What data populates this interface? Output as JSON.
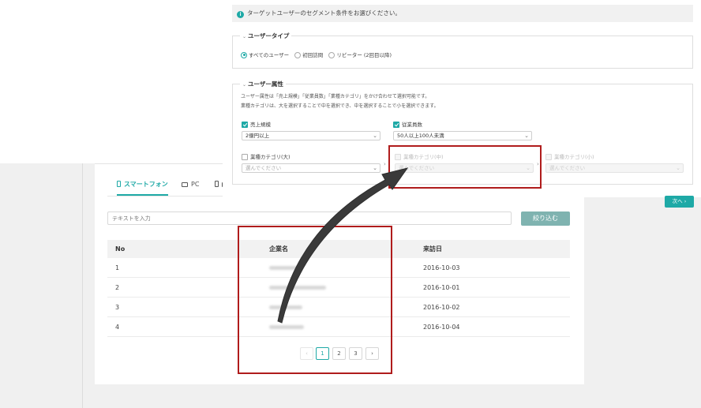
{
  "list": {
    "tabs": [
      {
        "label": "スマートフォン",
        "active": true
      },
      {
        "label": "PC",
        "active": false
      },
      {
        "label": "",
        "active": false
      }
    ],
    "search_placeholder": "テキストを入力",
    "filter_label": "絞り込む",
    "columns": [
      "No",
      "企業名",
      "来訪日"
    ],
    "rows": [
      {
        "no": "1",
        "date": "2016-10-03"
      },
      {
        "no": "2",
        "date": "2016-10-01"
      },
      {
        "no": "3",
        "date": "2016-10-02"
      },
      {
        "no": "4",
        "date": "2016-10-04"
      }
    ],
    "pagination": {
      "prev": "‹",
      "pages": [
        "1",
        "2",
        "3"
      ],
      "current": "1",
      "next": "›"
    }
  },
  "segment": {
    "info_text": "ターゲットユーザーのセグメント条件をお選びください。",
    "user_type": {
      "title": "ユーザータイプ",
      "options": [
        {
          "label": "すべてのユーザー",
          "selected": true
        },
        {
          "label": "初回訪問",
          "selected": false
        },
        {
          "label": "リピーター (2回目以降)",
          "selected": false
        }
      ]
    },
    "attributes": {
      "title": "ユーザー属性",
      "desc1": "ユーザー属性は「売上規模」「従業員数」「業種カテゴリ」をかけ合わせて選択可能です。",
      "desc2": "業種カテゴリは、大を選択することで中を選択でき、中を選択することで小を選択できます。",
      "sales": {
        "label": "売上規模",
        "checked": true,
        "value": "2億円以上"
      },
      "employees": {
        "label": "従業員数",
        "checked": true,
        "value": "50人以上100人未満"
      },
      "industry_large": {
        "label": "業種カテゴリ(大)",
        "checked": false,
        "placeholder": "選んでください"
      },
      "industry_medium": {
        "label": "業種カテゴリ(中)",
        "checked": false,
        "placeholder": "選んでください"
      },
      "industry_small": {
        "label": "業種カテゴリ(小)",
        "checked": false,
        "placeholder": "選んでください"
      }
    },
    "next_label": "次へ ›"
  },
  "colors": {
    "accent": "#1ea9a6",
    "highlight": "#b01c1c",
    "arrow": "#3a3a3a"
  }
}
